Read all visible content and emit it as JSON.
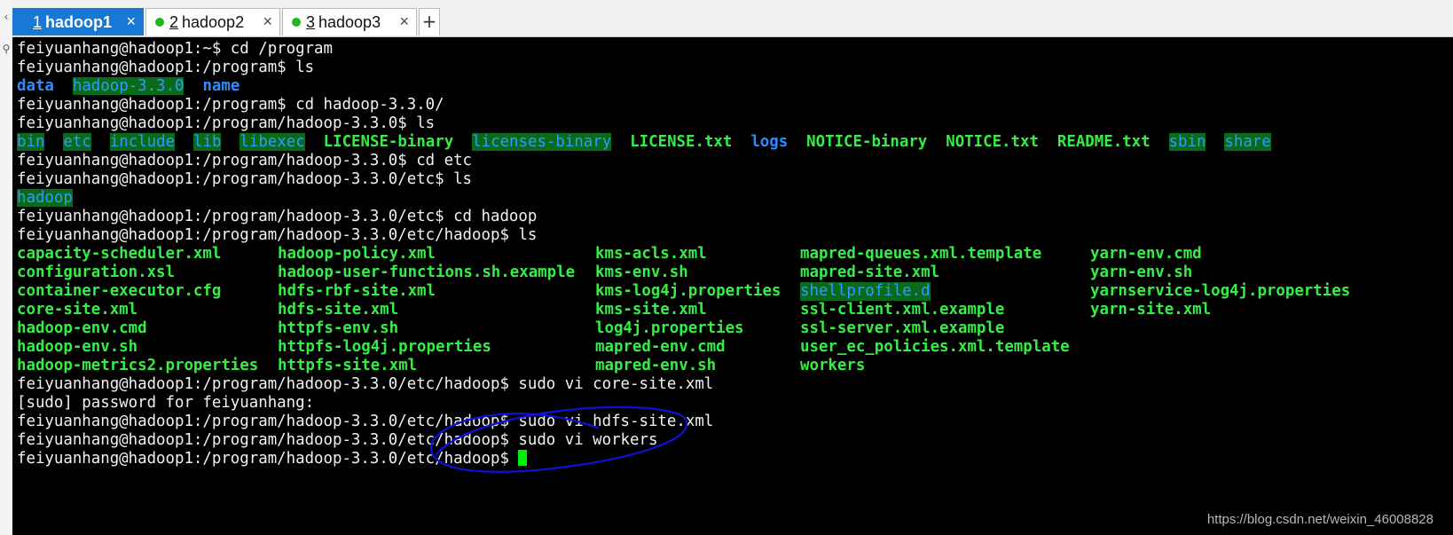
{
  "tabs": [
    {
      "number": "1",
      "name": "hadoop1",
      "active": true
    },
    {
      "number": "2",
      "name": "hadoop2",
      "active": false
    },
    {
      "number": "3",
      "name": "hadoop3",
      "active": false
    }
  ],
  "tab_close_glyph": "×",
  "new_tab_glyph": "+",
  "left_toolbar": {
    "top_icon": "‹",
    "search_icon": "⚲"
  },
  "terminal": {
    "lines": [
      "feiyuanhang@hadoop1:~$ cd /program",
      "feiyuanhang@hadoop1:/program$ ls",
      "",
      "feiyuanhang@hadoop1:/program$ cd hadoop-3.3.0/",
      "feiyuanhang@hadoop1:/program/hadoop-3.3.0$ ls",
      "",
      "feiyuanhang@hadoop1:/program/hadoop-3.3.0$ cd etc",
      "feiyuanhang@hadoop1:/program/hadoop-3.3.0/etc$ ls",
      "",
      "feiyuanhang@hadoop1:/program/hadoop-3.3.0/etc$ cd hadoop",
      "feiyuanhang@hadoop1:/program/hadoop-3.3.0/etc/hadoop$ ls"
    ],
    "ls_program": [
      "data",
      "hadoop-3.3.0",
      "name"
    ],
    "ls_hadoop_root": [
      "bin",
      "etc",
      "include",
      "lib",
      "libexec",
      "LICENSE-binary",
      "licenses-binary",
      "LICENSE.txt",
      "logs",
      "NOTICE-binary",
      "NOTICE.txt",
      "README.txt",
      "sbin",
      "share"
    ],
    "ls_etc": [
      "hadoop"
    ],
    "ls_hadoop_conf": [
      [
        "capacity-scheduler.xml",
        "configuration.xsl",
        "container-executor.cfg",
        "core-site.xml",
        "hadoop-env.cmd",
        "hadoop-env.sh",
        "hadoop-metrics2.properties"
      ],
      [
        "hadoop-policy.xml",
        "hadoop-user-functions.sh.example",
        "hdfs-rbf-site.xml",
        "hdfs-site.xml",
        "httpfs-env.sh",
        "httpfs-log4j.properties",
        "httpfs-site.xml"
      ],
      [
        "kms-acls.xml",
        "kms-env.sh",
        "kms-log4j.properties",
        "kms-site.xml",
        "log4j.properties",
        "mapred-env.cmd",
        "mapred-env.sh"
      ],
      [
        "mapred-queues.xml.template",
        "mapred-site.xml",
        "shellprofile.d",
        "ssl-client.xml.example",
        "ssl-server.xml.example",
        "user_ec_policies.xml.template",
        "workers"
      ],
      [
        "yarn-env.cmd",
        "yarn-env.sh",
        "yarnservice-log4j.properties",
        "yarn-site.xml"
      ]
    ],
    "after_lines": [
      "feiyuanhang@hadoop1:/program/hadoop-3.3.0/etc/hadoop$ sudo vi core-site.xml",
      "[sudo] password for feiyuanhang:",
      "feiyuanhang@hadoop1:/program/hadoop-3.3.0/etc/hadoop$ sudo vi hdfs-site.xml",
      "feiyuanhang@hadoop1:/program/hadoop-3.3.0/etc/hadoop$ sudo vi workers",
      "feiyuanhang@hadoop1:/program/hadoop-3.3.0/etc/hadoop$ "
    ]
  },
  "colors": {
    "terminal_bg": "#000000",
    "text": "#f2f2f2",
    "directory": "#2d8cff",
    "executable": "#35ee45",
    "highlight_bg": "#0a6a1a",
    "active_tab": "#1778d6",
    "annotation": "#1010d8"
  },
  "watermark": "https://blog.csdn.net/weixin_46008828"
}
